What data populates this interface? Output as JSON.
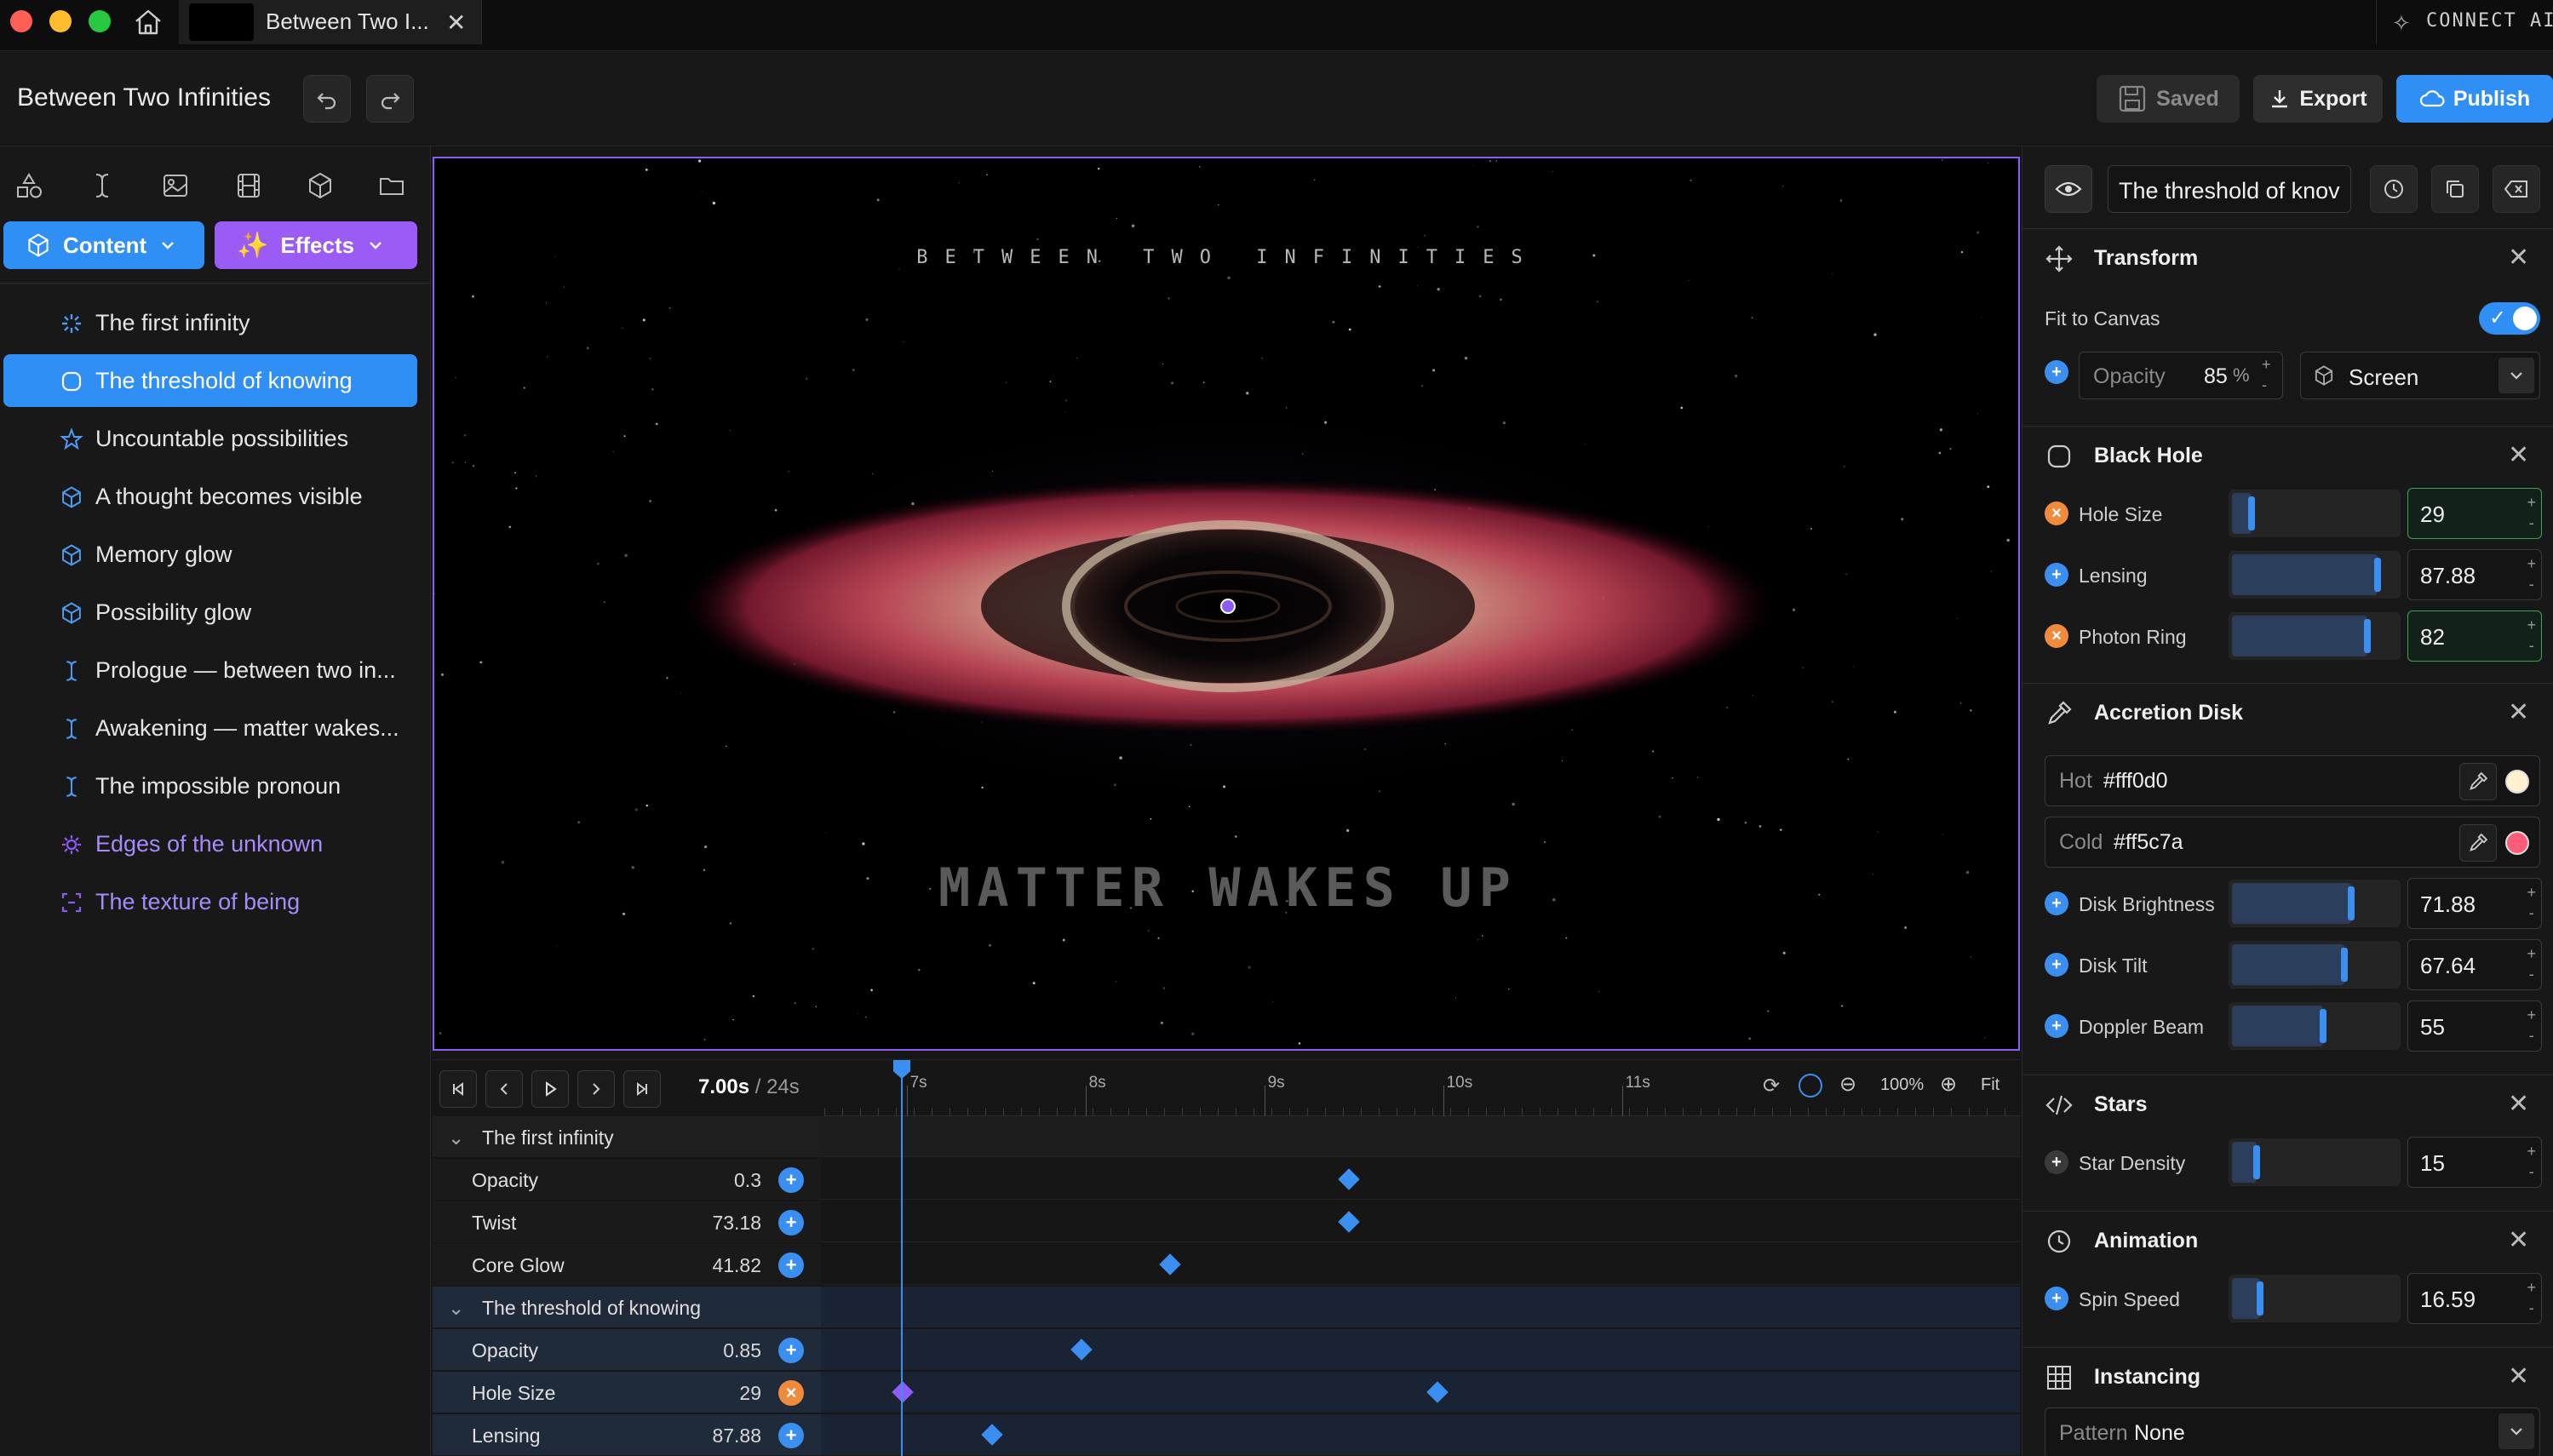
{
  "window": {
    "tab_title": "Between Two I...",
    "connect_label": "CONNECT AI"
  },
  "header": {
    "project_title": "Between Two Infinities",
    "saved_label": "Saved",
    "export_label": "Export",
    "publish_label": "Publish"
  },
  "left": {
    "content_label": "Content",
    "effects_label": "Effects",
    "layers": [
      {
        "label": "The first infinity",
        "icon": "sparkle-icon",
        "color": "#e6e6e6"
      },
      {
        "label": "The threshold of knowing",
        "icon": "circle-icon",
        "color": "#ffffff",
        "selected": true
      },
      {
        "label": "Uncountable possibilities",
        "icon": "star-icon",
        "color": "#e6e6e6"
      },
      {
        "label": "A thought becomes visible",
        "icon": "cube-icon",
        "color": "#e6e6e6"
      },
      {
        "label": "Memory glow",
        "icon": "cube-icon",
        "color": "#e6e6e6"
      },
      {
        "label": "Possibility glow",
        "icon": "cube-icon",
        "color": "#e6e6e6"
      },
      {
        "label": "Prologue — between two in...",
        "icon": "text-cursor-icon",
        "color": "#e6e6e6"
      },
      {
        "label": "Awakening — matter wakes...",
        "icon": "text-cursor-icon",
        "color": "#e6e6e6"
      },
      {
        "label": "The impossible pronoun",
        "icon": "text-cursor-icon",
        "color": "#e6e6e6"
      },
      {
        "label": "Edges of the unknown",
        "icon": "gear-icon",
        "color": "#a78bfa"
      },
      {
        "label": "The texture of being",
        "icon": "frame-icon",
        "color": "#a78bfa"
      }
    ]
  },
  "canvas": {
    "subtitle": "BETWEEN TWO INFINITIES",
    "main_text": "MATTER WAKES UP"
  },
  "timeline": {
    "current": "7.00s",
    "total": "/ 24s",
    "zoom": "100%",
    "fit": "Fit",
    "ticks": [
      "7s",
      "8s",
      "9s",
      "10s",
      "11s"
    ],
    "rows": [
      {
        "type": "group",
        "name": "The first infinity"
      },
      {
        "type": "param",
        "name": "Opacity",
        "value": "0.3",
        "key": "blue"
      },
      {
        "type": "param",
        "name": "Twist",
        "value": "73.18",
        "key": "blue"
      },
      {
        "type": "param",
        "name": "Core Glow",
        "value": "41.82",
        "key": "blue"
      },
      {
        "type": "group",
        "name": "The threshold of knowing",
        "sel": true
      },
      {
        "type": "param",
        "name": "Opacity",
        "value": "0.85",
        "key": "blue",
        "sel": true
      },
      {
        "type": "param",
        "name": "Hole Size",
        "value": "29",
        "key": "orange",
        "sel": true
      },
      {
        "type": "param",
        "name": "Lensing",
        "value": "87.88",
        "key": "blue",
        "sel": true
      }
    ]
  },
  "right": {
    "layer_name": "The threshold of knov",
    "transform": {
      "title": "Transform",
      "fit_label": "Fit to Canvas",
      "opacity_label": "Opacity",
      "opacity_value": "85",
      "opacity_unit": "%",
      "blend": "Screen"
    },
    "blackhole": {
      "title": "Black Hole",
      "params": [
        {
          "label": "Hole Size",
          "value": "29",
          "level": 0.12,
          "dot": "orange",
          "green": true
        },
        {
          "label": "Lensing",
          "value": "87.88",
          "level": 0.88,
          "dot": "blue",
          "green": false
        },
        {
          "label": "Photon Ring",
          "value": "82",
          "level": 0.82,
          "dot": "orange",
          "green": true
        }
      ]
    },
    "accretion": {
      "title": "Accretion Disk",
      "hot_label": "Hot",
      "hot_value": "#fff0d0",
      "hot_color": "#fff0d0",
      "cold_label": "Cold",
      "cold_value": "#ff5c7a",
      "cold_color": "#ff5c7a",
      "params": [
        {
          "label": "Disk Brightness",
          "value": "71.88",
          "level": 0.72,
          "dot": "blue"
        },
        {
          "label": "Disk Tilt",
          "value": "67.64",
          "level": 0.68,
          "dot": "blue"
        },
        {
          "label": "Doppler Beam",
          "value": "55",
          "level": 0.55,
          "dot": "blue"
        }
      ]
    },
    "stars": {
      "title": "Stars",
      "params": [
        {
          "label": "Star Density",
          "value": "15",
          "level": 0.15,
          "dot": "grey"
        }
      ]
    },
    "animation": {
      "title": "Animation",
      "params": [
        {
          "label": "Spin Speed",
          "value": "16.59",
          "level": 0.17,
          "dot": "blue"
        }
      ]
    },
    "instancing": {
      "title": "Instancing",
      "pattern_label": "Pattern",
      "pattern_value": "None"
    }
  },
  "colors": {
    "accent": "#3b8ff0",
    "purple": "#8b5cf6",
    "orange": "#f08a3c",
    "green": "#3fa34d"
  }
}
